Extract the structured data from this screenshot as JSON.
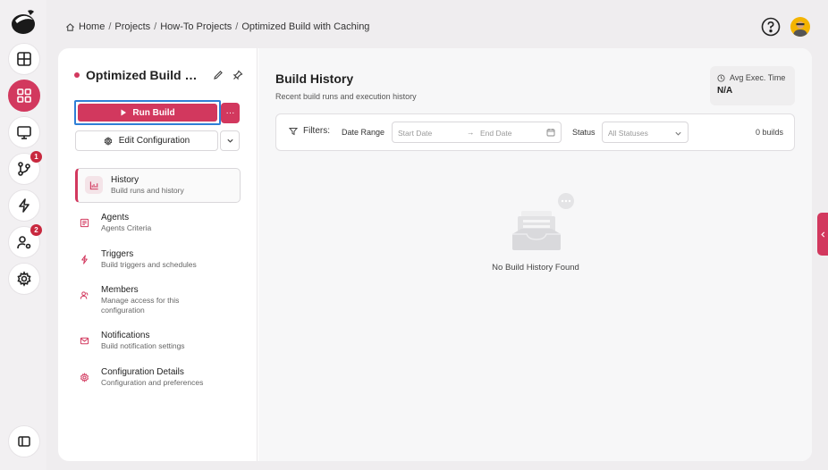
{
  "breadcrumb": {
    "items": [
      "Home",
      "Projects",
      "How-To Projects",
      "Optimized Build with Caching"
    ],
    "separator": "/"
  },
  "rail": {
    "items": [
      {
        "name": "layout",
        "icon": "layout-icon",
        "badge": ""
      },
      {
        "name": "dashboard",
        "icon": "grid-icon",
        "badge": "",
        "active": true
      },
      {
        "name": "monitor",
        "icon": "monitor-icon",
        "badge": ""
      },
      {
        "name": "source-control",
        "icon": "git-branch-icon",
        "badge": "1"
      },
      {
        "name": "automation",
        "icon": "lightning-icon",
        "badge": ""
      },
      {
        "name": "users",
        "icon": "user-settings-icon",
        "badge": "2"
      },
      {
        "name": "settings",
        "icon": "gear-icon",
        "badge": ""
      }
    ]
  },
  "config": {
    "title": "Optimized Build wi...",
    "run_label": "Run Build",
    "more_label": "···",
    "edit_label": "Edit Configuration"
  },
  "nav": [
    {
      "title": "History",
      "subtitle": "Build runs and history"
    },
    {
      "title": "Agents",
      "subtitle": "Agents Criteria"
    },
    {
      "title": "Triggers",
      "subtitle": "Build triggers and schedules"
    },
    {
      "title": "Members",
      "subtitle": "Manage access for this configuration"
    },
    {
      "title": "Notifications",
      "subtitle": "Build notification settings"
    },
    {
      "title": "Configuration Details",
      "subtitle": "Configuration and preferences"
    }
  ],
  "main": {
    "title": "Build History",
    "subtitle": "Recent build runs and execution history",
    "avg_label": "Avg Exec. Time",
    "avg_value": "N/A"
  },
  "filters": {
    "label": "Filters:",
    "date_label": "Date Range",
    "start_placeholder": "Start Date",
    "arrow": "→",
    "end_placeholder": "End Date",
    "status_label": "Status",
    "status_value": "All Statuses",
    "count": "0 builds"
  },
  "empty_state": {
    "text": "No Build History Found"
  },
  "colors": {
    "accent": "#d2385e",
    "focus": "#2f7fd6",
    "badge": "#c8283e"
  }
}
